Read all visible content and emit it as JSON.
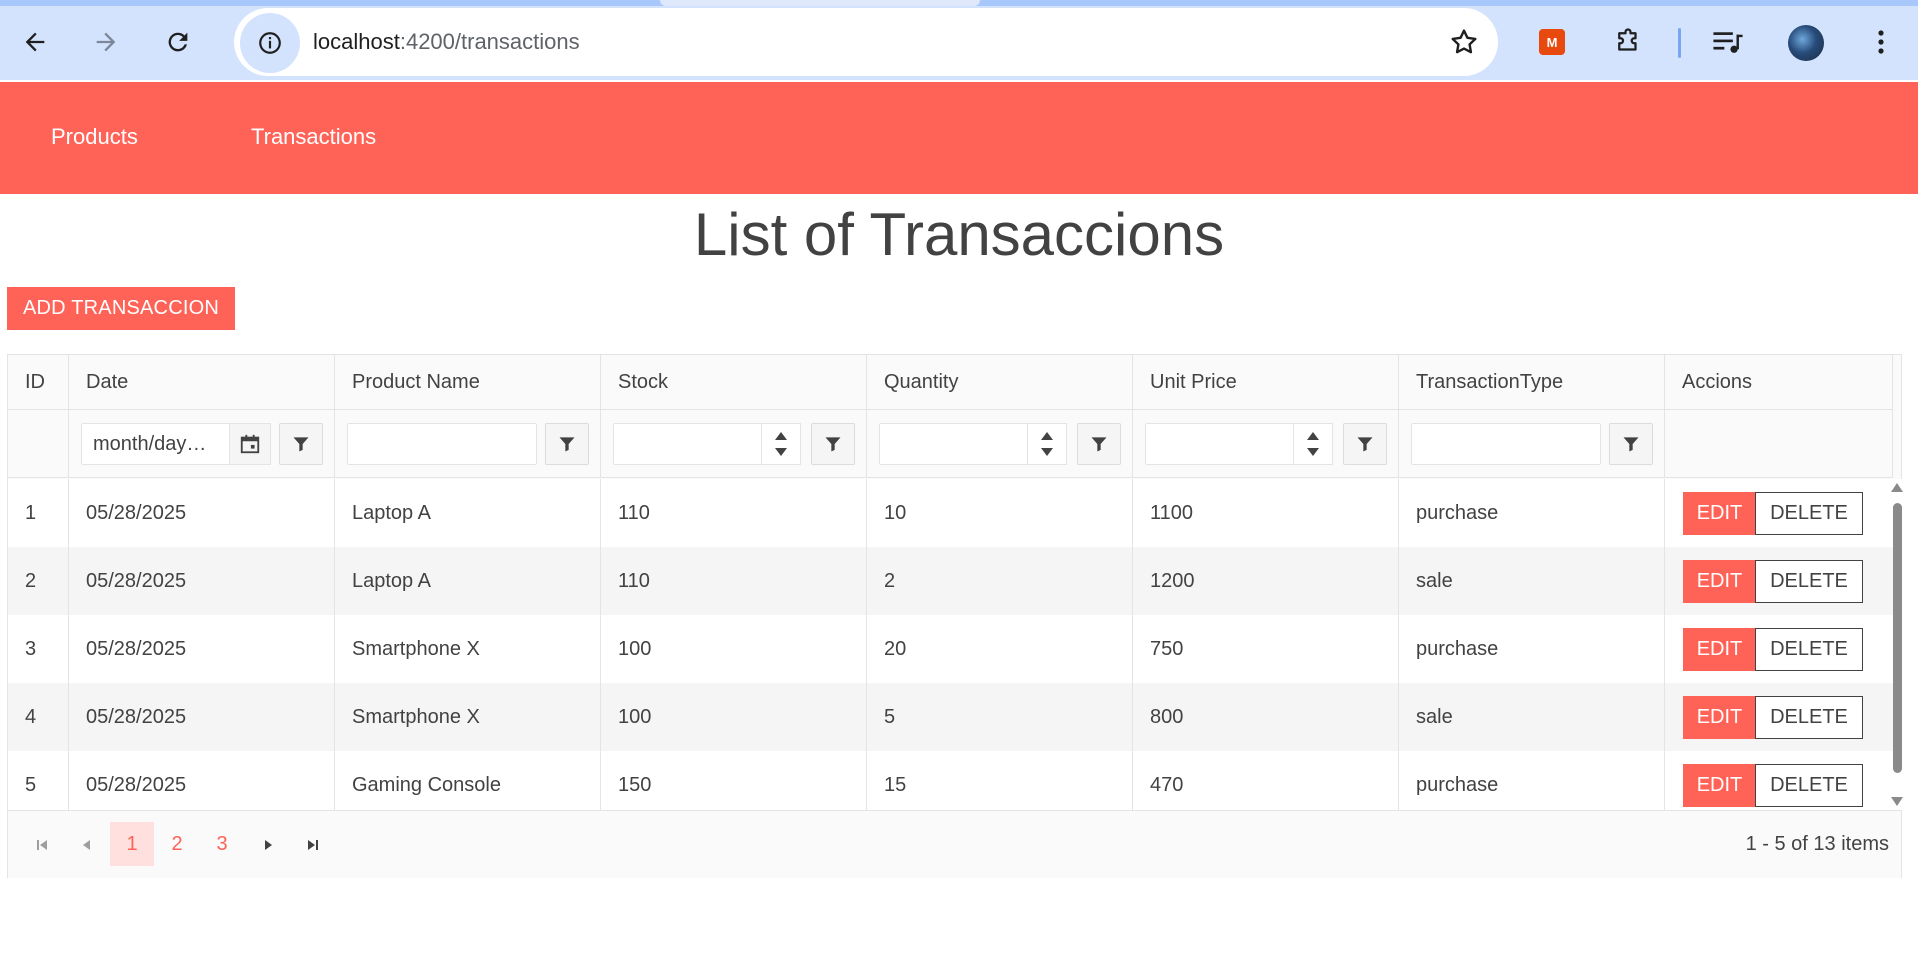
{
  "browser": {
    "url_host": "localhost",
    "url_path": ":4200/transactions",
    "extension_badge": "M"
  },
  "nav": {
    "items": [
      "Products",
      "Transactions"
    ]
  },
  "page": {
    "title": "List of Transaccions",
    "add_button": "ADD TRANSACCION"
  },
  "grid": {
    "columns": [
      "ID",
      "Date",
      "Product Name",
      "Stock",
      "Quantity",
      "Unit Price",
      "TransactionType",
      "Accions"
    ],
    "filters": {
      "date_placeholder": "month/day…"
    },
    "rows": [
      {
        "id": "1",
        "date": "05/28/2025",
        "product": "Laptop A",
        "stock": "110",
        "quantity": "10",
        "unit_price": "1100",
        "type": "purchase"
      },
      {
        "id": "2",
        "date": "05/28/2025",
        "product": "Laptop A",
        "stock": "110",
        "quantity": "2",
        "unit_price": "1200",
        "type": "sale"
      },
      {
        "id": "3",
        "date": "05/28/2025",
        "product": "Smartphone X",
        "stock": "100",
        "quantity": "20",
        "unit_price": "750",
        "type": "purchase"
      },
      {
        "id": "4",
        "date": "05/28/2025",
        "product": "Smartphone X",
        "stock": "100",
        "quantity": "5",
        "unit_price": "800",
        "type": "sale"
      },
      {
        "id": "5",
        "date": "05/28/2025",
        "product": "Gaming Console",
        "stock": "150",
        "quantity": "15",
        "unit_price": "470",
        "type": "purchase"
      }
    ],
    "actions": {
      "edit": "EDIT",
      "delete": "DELETE"
    },
    "pager": {
      "pages": [
        "1",
        "2",
        "3"
      ],
      "current": "1",
      "info": "1 - 5 of 13 items"
    }
  },
  "colors": {
    "accent": "#ff6358",
    "chrome": "#d3e3fd"
  }
}
